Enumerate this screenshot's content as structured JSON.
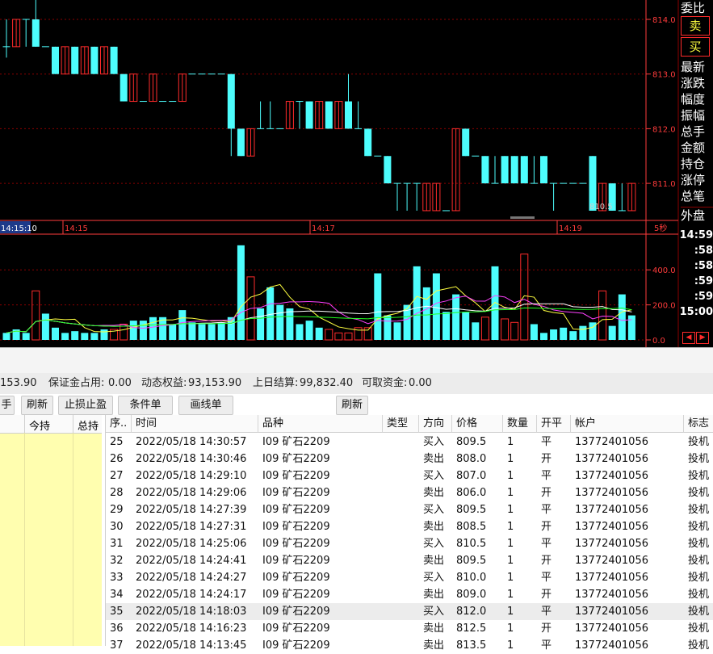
{
  "colors": {
    "up": "#ff2b2b",
    "down": "#4dfdfd",
    "grid": "#8b0000",
    "axis": "#ff3b3b",
    "ma5": "#ffffff",
    "ma10": "#ffff40",
    "ma20": "#ff40ff",
    "ma60": "#20ff20"
  },
  "price_axis": [
    "814.0",
    "813.0",
    "812.0",
    "811.0"
  ],
  "time_axis": {
    "current": "14:15:10",
    "t1": "14:15",
    "t2": "14:17",
    "t3": "14:19",
    "period": "5秒"
  },
  "volume_axis": [
    "400.0",
    "200.0",
    "0.0"
  ],
  "last_price_label": "810.5",
  "side_labels": [
    "委比",
    "卖",
    "买",
    "最新",
    "涨跌",
    "幅度",
    "振幅",
    "总手",
    "金额",
    "持仓",
    "涨停",
    "总笔",
    "外盘"
  ],
  "side_times": [
    "14:59",
    ":58",
    ":58",
    ":59",
    ":59",
    "15:00"
  ],
  "nav_arrows": {
    "left": "◀",
    "right": "▶"
  },
  "chart_data": {
    "type": "candlestick",
    "ylim": [
      810.5,
      814.3
    ],
    "candles": [
      [
        813.5,
        813.5,
        814.0,
        813.3
      ],
      [
        813.5,
        814.0,
        814.0,
        813.5
      ],
      [
        814.0,
        814.0,
        814.0,
        813.5
      ],
      [
        814.0,
        813.5,
        814.5,
        813.5
      ],
      [
        813.5,
        813.5,
        813.5,
        813.5
      ],
      [
        813.5,
        813.0,
        813.5,
        813.0
      ],
      [
        813.0,
        813.5,
        813.5,
        813.0
      ],
      [
        813.5,
        813.0,
        813.5,
        813.0
      ],
      [
        813.0,
        813.5,
        813.5,
        813.0
      ],
      [
        813.5,
        813.0,
        813.5,
        813.0
      ],
      [
        813.0,
        813.5,
        813.5,
        813.0
      ],
      [
        813.5,
        813.0,
        813.5,
        813.0
      ],
      [
        813.0,
        812.5,
        813.0,
        812.5
      ],
      [
        812.5,
        813.0,
        813.0,
        812.5
      ],
      [
        812.5,
        812.5,
        812.5,
        812.5
      ],
      [
        812.5,
        813.0,
        813.0,
        812.5
      ],
      [
        812.5,
        812.5,
        812.5,
        812.5
      ],
      [
        812.5,
        812.5,
        812.5,
        812.5
      ],
      [
        812.5,
        813.0,
        813.0,
        812.5
      ],
      [
        813.0,
        813.0,
        813.0,
        813.0
      ],
      [
        813.0,
        813.0,
        813.0,
        813.0
      ],
      [
        813.0,
        813.0,
        813.0,
        813.0
      ],
      [
        813.0,
        813.0,
        813.0,
        813.0
      ],
      [
        813.0,
        812.0,
        813.0,
        811.5
      ],
      [
        812.0,
        811.5,
        812.0,
        811.5
      ],
      [
        811.5,
        812.0,
        812.0,
        811.5
      ],
      [
        812.0,
        812.0,
        812.5,
        812.0
      ],
      [
        812.0,
        812.0,
        812.5,
        812.0
      ],
      [
        812.0,
        812.0,
        812.0,
        812.0
      ],
      [
        812.0,
        812.5,
        812.5,
        812.0
      ],
      [
        812.5,
        812.5,
        812.5,
        812.0
      ],
      [
        812.5,
        812.0,
        812.5,
        812.0
      ],
      [
        812.0,
        812.5,
        812.5,
        812.0
      ],
      [
        812.5,
        812.0,
        812.5,
        812.0
      ],
      [
        812.0,
        812.5,
        812.5,
        812.0
      ],
      [
        812.5,
        812.0,
        813.0,
        812.0
      ],
      [
        812.0,
        812.0,
        812.5,
        812.0
      ],
      [
        812.0,
        811.5,
        812.0,
        811.5
      ],
      [
        811.5,
        811.5,
        811.5,
        811.5
      ],
      [
        811.5,
        811.0,
        811.5,
        811.0
      ],
      [
        811.0,
        811.0,
        811.0,
        810.5
      ],
      [
        811.0,
        811.0,
        811.0,
        810.5
      ],
      [
        811.0,
        811.0,
        811.0,
        810.5
      ],
      [
        810.5,
        811.0,
        811.0,
        810.5
      ],
      [
        810.5,
        811.0,
        811.0,
        810.5
      ],
      [
        810.5,
        810.5,
        810.5,
        810.5
      ],
      [
        810.5,
        812.0,
        812.0,
        810.5
      ],
      [
        812.0,
        811.5,
        812.0,
        811.5
      ],
      [
        811.5,
        811.5,
        811.5,
        811.5
      ],
      [
        811.5,
        811.0,
        811.5,
        811.0
      ],
      [
        811.0,
        811.0,
        811.5,
        811.0
      ],
      [
        811.5,
        811.0,
        811.5,
        811.0
      ],
      [
        811.5,
        811.0,
        811.5,
        811.0
      ],
      [
        811.5,
        811.0,
        811.5,
        811.0
      ],
      [
        811.0,
        811.0,
        811.5,
        811.0
      ],
      [
        811.5,
        811.0,
        811.5,
        811.0
      ],
      [
        811.0,
        811.0,
        811.0,
        810.5
      ],
      [
        811.0,
        811.0,
        811.0,
        811.0
      ],
      [
        811.0,
        811.0,
        811.0,
        811.0
      ],
      [
        811.0,
        811.0,
        811.0,
        811.0
      ],
      [
        811.5,
        810.5,
        811.5,
        810.5
      ],
      [
        810.5,
        811.0,
        811.0,
        810.5
      ],
      [
        811.0,
        810.5,
        811.0,
        810.5
      ],
      [
        810.5,
        810.5,
        811.0,
        810.5
      ],
      [
        810.5,
        811.0,
        811.0,
        810.5
      ]
    ],
    "volume_ylim": [
      0,
      600
    ],
    "volumes": [
      [
        40,
        "d"
      ],
      [
        60,
        "d"
      ],
      [
        40,
        "d"
      ],
      [
        280,
        "u"
      ],
      [
        150,
        "d"
      ],
      [
        70,
        "d"
      ],
      [
        40,
        "d"
      ],
      [
        50,
        "d"
      ],
      [
        40,
        "d"
      ],
      [
        40,
        "d"
      ],
      [
        60,
        "d"
      ],
      [
        60,
        "u"
      ],
      [
        90,
        "u"
      ],
      [
        110,
        "d"
      ],
      [
        110,
        "d"
      ],
      [
        130,
        "d"
      ],
      [
        130,
        "d"
      ],
      [
        90,
        "d"
      ],
      [
        170,
        "d"
      ],
      [
        100,
        "d"
      ],
      [
        90,
        "d"
      ],
      [
        90,
        "d"
      ],
      [
        100,
        "d"
      ],
      [
        130,
        "d"
      ],
      [
        540,
        "d"
      ],
      [
        360,
        "u"
      ],
      [
        180,
        "d"
      ],
      [
        300,
        "d"
      ],
      [
        200,
        "d"
      ],
      [
        180,
        "d"
      ],
      [
        90,
        "d"
      ],
      [
        110,
        "d"
      ],
      [
        70,
        "d"
      ],
      [
        60,
        "u"
      ],
      [
        40,
        "u"
      ],
      [
        40,
        "u"
      ],
      [
        70,
        "u"
      ],
      [
        70,
        "u"
      ],
      [
        380,
        "d"
      ],
      [
        140,
        "d"
      ],
      [
        100,
        "d"
      ],
      [
        200,
        "d"
      ],
      [
        420,
        "d"
      ],
      [
        300,
        "d"
      ],
      [
        380,
        "d"
      ],
      [
        160,
        "d"
      ],
      [
        260,
        "d"
      ],
      [
        160,
        "d"
      ],
      [
        100,
        "d"
      ],
      [
        130,
        "u"
      ],
      [
        420,
        "d"
      ],
      [
        120,
        "u"
      ],
      [
        100,
        "u"
      ],
      [
        490,
        "u"
      ],
      [
        90,
        "d"
      ],
      [
        40,
        "d"
      ],
      [
        60,
        "d"
      ],
      [
        70,
        "d"
      ],
      [
        50,
        "d"
      ],
      [
        80,
        "d"
      ],
      [
        100,
        "d"
      ],
      [
        280,
        "u"
      ],
      [
        80,
        "d"
      ],
      [
        260,
        "d"
      ],
      [
        140,
        "d"
      ]
    ]
  },
  "account": {
    "equity_prefix": "153.90",
    "margin_label": "保证金占用:",
    "margin_value": "0.00",
    "dynamic_label": "动态权益:",
    "dynamic_value": "93,153.90",
    "settle_label": "上日结算:",
    "settle_value": "99,832.40",
    "avail_label": "可取资金:",
    "avail_value": "0.00"
  },
  "toolbar": {
    "hand": "手",
    "refresh": "刷新",
    "stop": "止损止盈",
    "cond": "条件单",
    "draw": "画线单",
    "refresh2": "刷新"
  },
  "left_headers": [
    "今持",
    "总持"
  ],
  "table": {
    "headers": [
      "序..",
      "时间",
      "品种",
      "类型",
      "方向",
      "价格",
      "数量",
      "开平",
      "帐户",
      "标志"
    ],
    "rows": [
      [
        "25",
        "2022/05/18 14:30:57",
        "I09 矿石2209",
        "",
        "买入",
        "809.5",
        "1",
        "平",
        "13772401056",
        "投机"
      ],
      [
        "26",
        "2022/05/18 14:30:46",
        "I09 矿石2209",
        "",
        "卖出",
        "808.0",
        "1",
        "开",
        "13772401056",
        "投机"
      ],
      [
        "27",
        "2022/05/18 14:29:10",
        "I09 矿石2209",
        "",
        "买入",
        "807.0",
        "1",
        "平",
        "13772401056",
        "投机"
      ],
      [
        "28",
        "2022/05/18 14:29:06",
        "I09 矿石2209",
        "",
        "卖出",
        "806.0",
        "1",
        "开",
        "13772401056",
        "投机"
      ],
      [
        "29",
        "2022/05/18 14:27:39",
        "I09 矿石2209",
        "",
        "买入",
        "809.5",
        "1",
        "平",
        "13772401056",
        "投机"
      ],
      [
        "30",
        "2022/05/18 14:27:31",
        "I09 矿石2209",
        "",
        "卖出",
        "808.5",
        "1",
        "开",
        "13772401056",
        "投机"
      ],
      [
        "31",
        "2022/05/18 14:25:06",
        "I09 矿石2209",
        "",
        "买入",
        "810.5",
        "1",
        "平",
        "13772401056",
        "投机"
      ],
      [
        "32",
        "2022/05/18 14:24:41",
        "I09 矿石2209",
        "",
        "卖出",
        "809.5",
        "1",
        "开",
        "13772401056",
        "投机"
      ],
      [
        "33",
        "2022/05/18 14:24:27",
        "I09 矿石2209",
        "",
        "买入",
        "810.0",
        "1",
        "平",
        "13772401056",
        "投机"
      ],
      [
        "34",
        "2022/05/18 14:24:17",
        "I09 矿石2209",
        "",
        "卖出",
        "809.0",
        "1",
        "开",
        "13772401056",
        "投机"
      ],
      [
        "35",
        "2022/05/18 14:18:03",
        "I09 矿石2209",
        "",
        "买入",
        "812.0",
        "1",
        "平",
        "13772401056",
        "投机"
      ],
      [
        "36",
        "2022/05/18 14:16:23",
        "I09 矿石2209",
        "",
        "卖出",
        "812.5",
        "1",
        "开",
        "13772401056",
        "投机"
      ],
      [
        "37",
        "2022/05/18 14:13:45",
        "I09 矿石2209",
        "",
        "卖出",
        "813.5",
        "1",
        "平",
        "13772401056",
        "投机"
      ]
    ],
    "selected_row": 10
  }
}
